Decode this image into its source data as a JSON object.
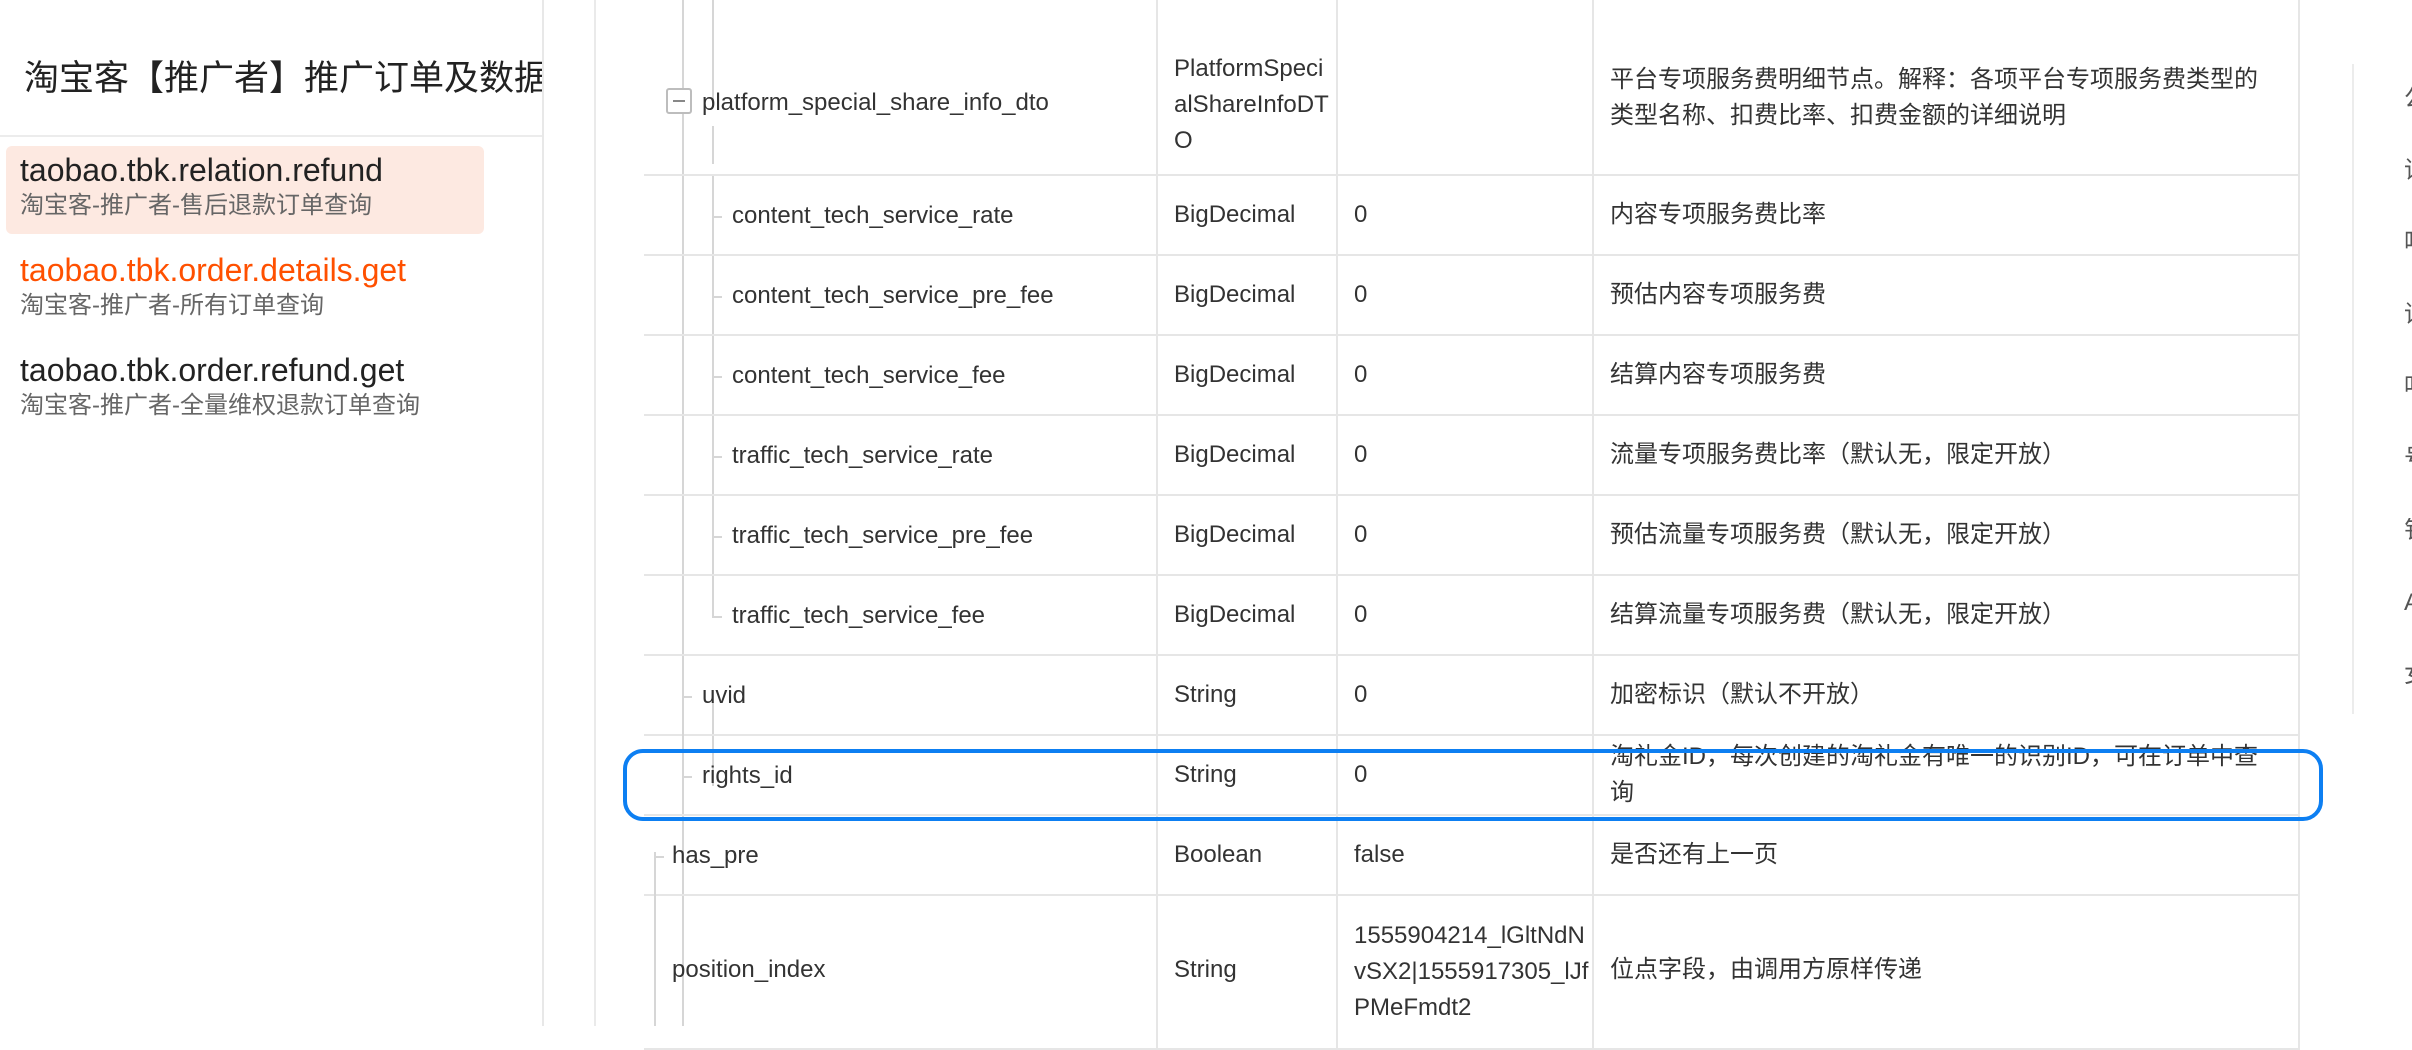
{
  "sidebar": {
    "title": "淘宝客【推广者】推广订单及数据",
    "items": [
      {
        "name": "taobao.tbk.relation.refund",
        "desc": "淘宝客-推广者-售后退款订单查询"
      },
      {
        "name": "taobao.tbk.order.details.get",
        "desc": "淘宝客-推广者-所有订单查询"
      },
      {
        "name": "taobao.tbk.order.refund.get",
        "desc": "淘宝客-推广者-全量维权退款订单查询"
      }
    ]
  },
  "rows": [
    {
      "name": "platform_special_share_info_dto",
      "type": "PlatformSpecialShareInfoDTO",
      "demo": "",
      "desc": "平台专项服务费明细节点。解释：各项平台专项服务费类型的类型名称、扣费比率、扣费金额的详细说明"
    },
    {
      "name": "content_tech_service_rate",
      "type": "BigDecimal",
      "demo": "0",
      "desc": "内容专项服务费比率"
    },
    {
      "name": "content_tech_service_pre_fee",
      "type": "BigDecimal",
      "demo": "0",
      "desc": "预估内容专项服务费"
    },
    {
      "name": "content_tech_service_fee",
      "type": "BigDecimal",
      "demo": "0",
      "desc": "结算内容专项服务费"
    },
    {
      "name": "traffic_tech_service_rate",
      "type": "BigDecimal",
      "demo": "0",
      "desc": "流量专项服务费比率（默认无，限定开放）"
    },
    {
      "name": "traffic_tech_service_pre_fee",
      "type": "BigDecimal",
      "demo": "0",
      "desc": "预估流量专项服务费（默认无，限定开放）"
    },
    {
      "name": "traffic_tech_service_fee",
      "type": "BigDecimal",
      "demo": "0",
      "desc": "结算流量专项服务费（默认无，限定开放）"
    },
    {
      "name": "uvid",
      "type": "String",
      "demo": "0",
      "desc": "加密标识（默认不开放）"
    },
    {
      "name": "rights_id",
      "type": "String",
      "demo": "0",
      "desc": "淘礼金ID，每次创建的淘礼金有唯一的识别ID，可在订单中查询"
    },
    {
      "name": "has_pre",
      "type": "Boolean",
      "demo": "false",
      "desc": "是否还有上一页"
    },
    {
      "name": "position_index",
      "type": "String",
      "demo": "1555904214_lGltNdNvSX2|1555917305_lJfPMeFmdt2",
      "desc": "位点字段，由调用方原样传递"
    }
  ],
  "right_rail": [
    "公",
    "请",
    "鸣",
    "请",
    "呫",
    "号",
    "钅",
    "A",
    "女"
  ]
}
